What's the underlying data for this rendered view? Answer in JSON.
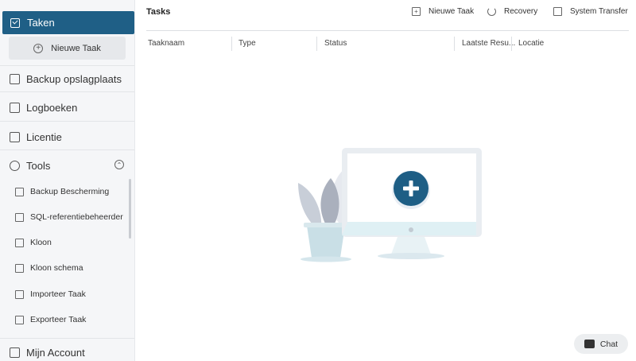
{
  "sidebar": {
    "active_item": "Taken",
    "new_task_label": "Nieuwe Taak",
    "items": [
      {
        "label": "Backup opslagplaats"
      },
      {
        "label": "Logboeken"
      },
      {
        "label": "Licentie"
      },
      {
        "label": "Tools"
      },
      {
        "label": "Mijn Account"
      }
    ],
    "tools_subitems": [
      {
        "label": "Backup Bescherming"
      },
      {
        "label": "SQL-referentiebeheerder"
      },
      {
        "label": "Kloon"
      },
      {
        "label": "Kloon schema"
      },
      {
        "label": "Importeer Taak"
      },
      {
        "label": "Exporteer Taak"
      }
    ]
  },
  "main": {
    "title": "Tasks",
    "toolbar": {
      "new_task": "Nieuwe Taak",
      "recovery": "Recovery",
      "system_transfer": "System Transfer"
    },
    "columns": [
      "Taaknaam",
      "Type",
      "Status",
      "Laatste Resu...",
      "Locatie"
    ]
  },
  "chat": {
    "label": "Chat"
  },
  "colors": {
    "accent": "#1f5f86",
    "sidebar_bg": "#f5f6f8"
  }
}
